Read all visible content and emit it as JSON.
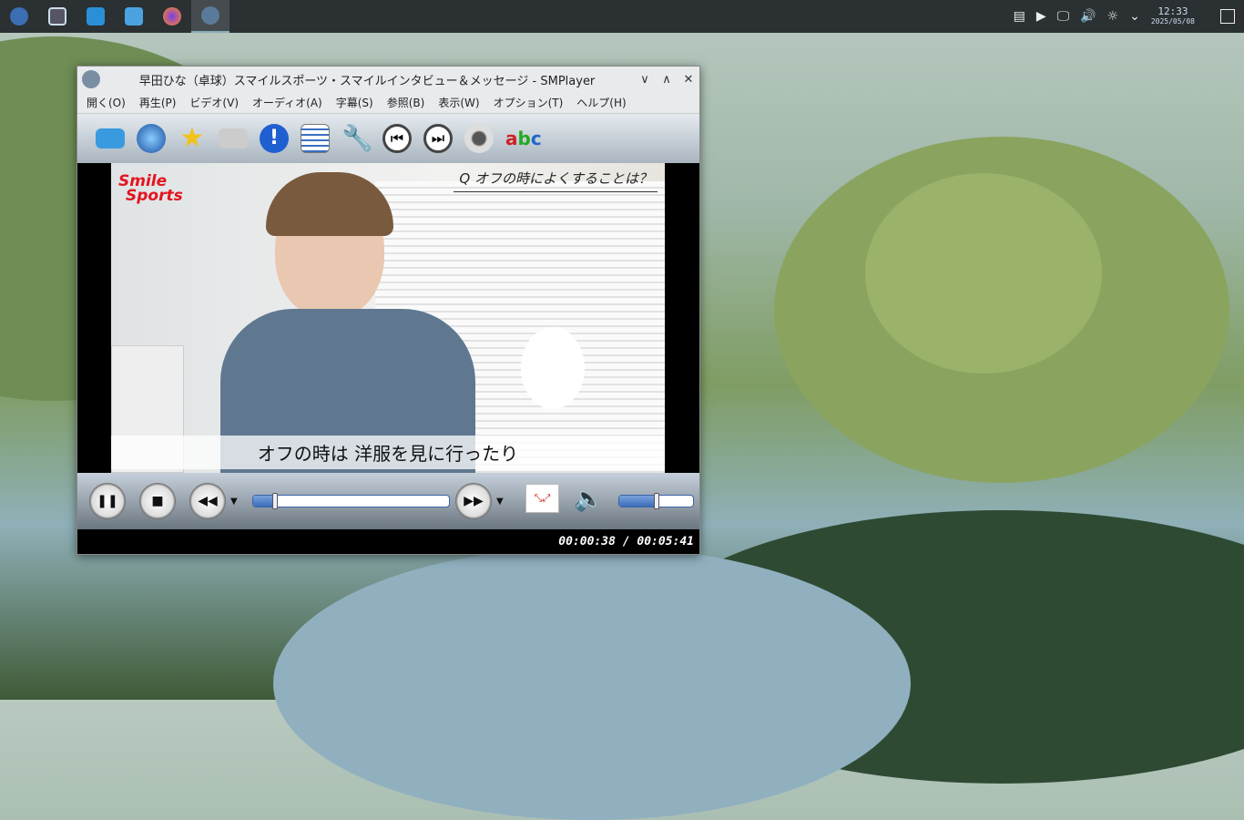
{
  "taskbar": {
    "apps": [
      "fedora-launcher",
      "task-manager",
      "store",
      "file-manager",
      "firefox",
      "smplayer"
    ]
  },
  "tray": {
    "time": "12:33",
    "date": "2025/05/08"
  },
  "window": {
    "title": "早田ひな（卓球）スマイルスポーツ・スマイルインタビュー＆メッセージ - SMPlayer",
    "menu": [
      "開く(O)",
      "再生(P)",
      "ビデオ(V)",
      "オーディオ(A)",
      "字幕(S)",
      "参照(B)",
      "表示(W)",
      "オプション(T)",
      "ヘルプ(H)"
    ]
  },
  "video": {
    "logo_line1": "Smile",
    "logo_line2": "Sports",
    "question": "Q オフの時によくすることは？",
    "subtitle": "オフの時は 洋服を見に行ったり"
  },
  "playback": {
    "current": "00:00:38",
    "total": "00:05:41",
    "time_display": "00:00:38 / 00:05:41",
    "progress": 0.111,
    "volume": 0.5
  }
}
